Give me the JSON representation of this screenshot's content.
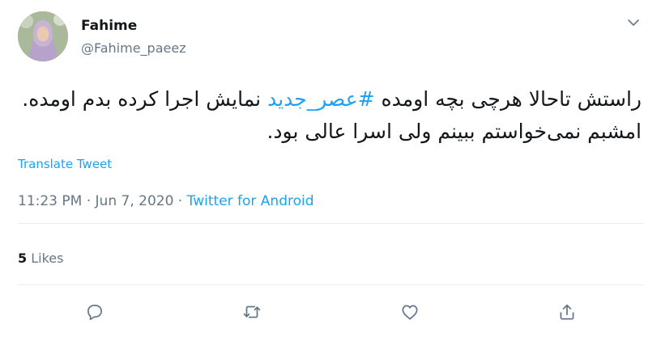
{
  "user": {
    "name": "Fahime",
    "handle": "@Fahime_paeez"
  },
  "tweet": {
    "text_before_hashtag": "راستش تاحالا هرچی بچه اومده ",
    "hashtag": "#عصر_جدید",
    "text_after_hashtag": " نمایش اجرا کرده بدم اومده. امشبم نمی‌خواستم ببینم ولی اسرا عالی بود."
  },
  "translate_label": "Translate Tweet",
  "meta": {
    "time": "11:23 PM",
    "separator": " · ",
    "date": "Jun 7, 2020",
    "source": "Twitter for Android"
  },
  "stats": {
    "likes_count": "5",
    "likes_label": " Likes"
  },
  "actions": [
    {
      "icon": "reply-icon"
    },
    {
      "icon": "retweet-icon"
    },
    {
      "icon": "like-icon"
    },
    {
      "icon": "share-icon"
    }
  ],
  "colors": {
    "accent": "#1da1f2",
    "muted": "#657786",
    "text": "#14171a",
    "divider": "#e6ecf0"
  }
}
